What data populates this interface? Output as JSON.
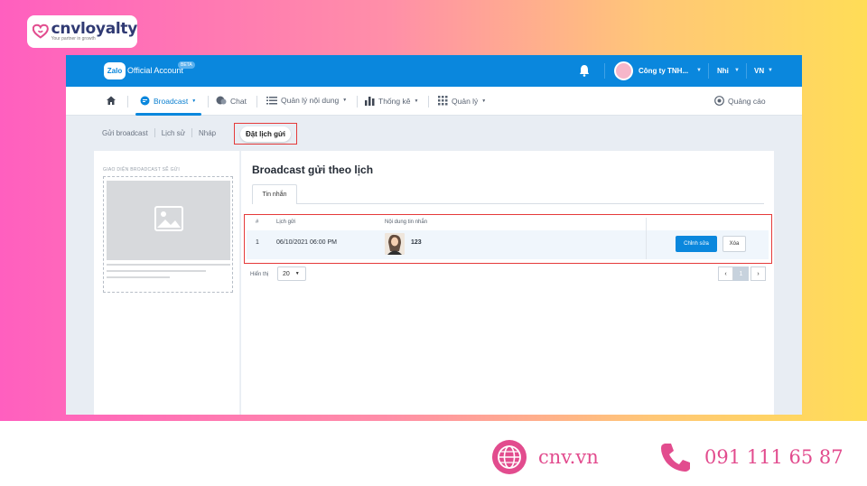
{
  "logo": {
    "brand": "cnvloyalty",
    "tagline": "Your partner in growth"
  },
  "topbar": {
    "zalo": "Zalo",
    "title": "Official Account",
    "beta": "BETA",
    "account_name": "Công ty TNH...",
    "user": "Nhi",
    "language": "VN"
  },
  "nav": {
    "home": "home-icon",
    "items": [
      {
        "label": "Broadcast",
        "active": true
      },
      {
        "label": "Chat",
        "active": false
      },
      {
        "label": "Quản lý nội dung",
        "active": false
      },
      {
        "label": "Thống kê",
        "active": false
      },
      {
        "label": "Quản lý",
        "active": false
      }
    ],
    "ads": "Quảng cáo"
  },
  "subtabs": [
    "Gửi broadcast",
    "Lịch sử",
    "Nháp"
  ],
  "subtab_active": "Đặt lịch gửi",
  "preview": {
    "label": "GIAO DIỆN BROADCAST SẼ GỬI"
  },
  "main": {
    "title": "Broadcast gửi theo lịch",
    "tab": "Tin nhắn",
    "table": {
      "headers": [
        "#",
        "Lịch gửi",
        "Nội dung tin nhắn"
      ],
      "rows": [
        {
          "index": "1",
          "schedule": "06/10/2021 06:00 PM",
          "content": "123"
        }
      ],
      "edit_label": "Chỉnh sửa",
      "delete_label": "Xóa"
    },
    "pager": {
      "label": "Hiển thị",
      "per_page": "20",
      "prev": "‹",
      "current": "1",
      "next": "›"
    }
  },
  "footer": {
    "website": "cnv.vn",
    "phone": "091 111 65 87"
  },
  "colors": {
    "accent": "#0a87dd",
    "highlight": "#e53a3a",
    "brand_pink": "#e24c8e"
  }
}
